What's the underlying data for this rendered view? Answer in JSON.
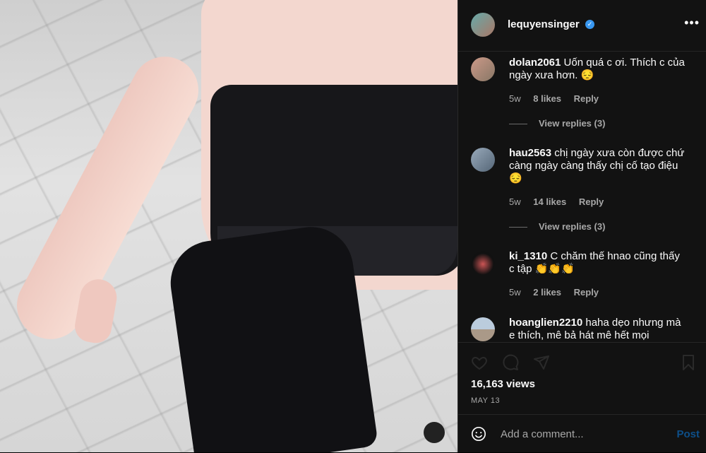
{
  "header": {
    "username": "lequyensinger",
    "verified_icon": "verified-badge-icon"
  },
  "comments": [
    {
      "username": "dolan2061",
      "text": "Uốn quá c ơi. Thích c của ngày xưa hơn. 😔",
      "time": "5w",
      "likes": "8 likes",
      "reply": "Reply",
      "view_replies": "View replies (3)"
    },
    {
      "username": "hau2563",
      "text": "chị ngày xưa còn được chứ càng ngày càng thấy chị cố tạo điệu 😔",
      "time": "5w",
      "likes": "14 likes",
      "reply": "Reply",
      "view_replies": "View replies (3)"
    },
    {
      "username": "ki_1310",
      "text": "C chăm thế hnao cũng thấy c tập 👏👏👏",
      "time": "5w",
      "likes": "2 likes",
      "reply": "Reply"
    },
    {
      "username": "hoanglien2210",
      "text": "haha dẹo nhưng mà e thích, mê bả hát mê hết mọi"
    }
  ],
  "stats": {
    "views": "16,163 views",
    "date": "MAY 13"
  },
  "composer": {
    "placeholder": "Add a comment...",
    "post_label": "Post"
  }
}
